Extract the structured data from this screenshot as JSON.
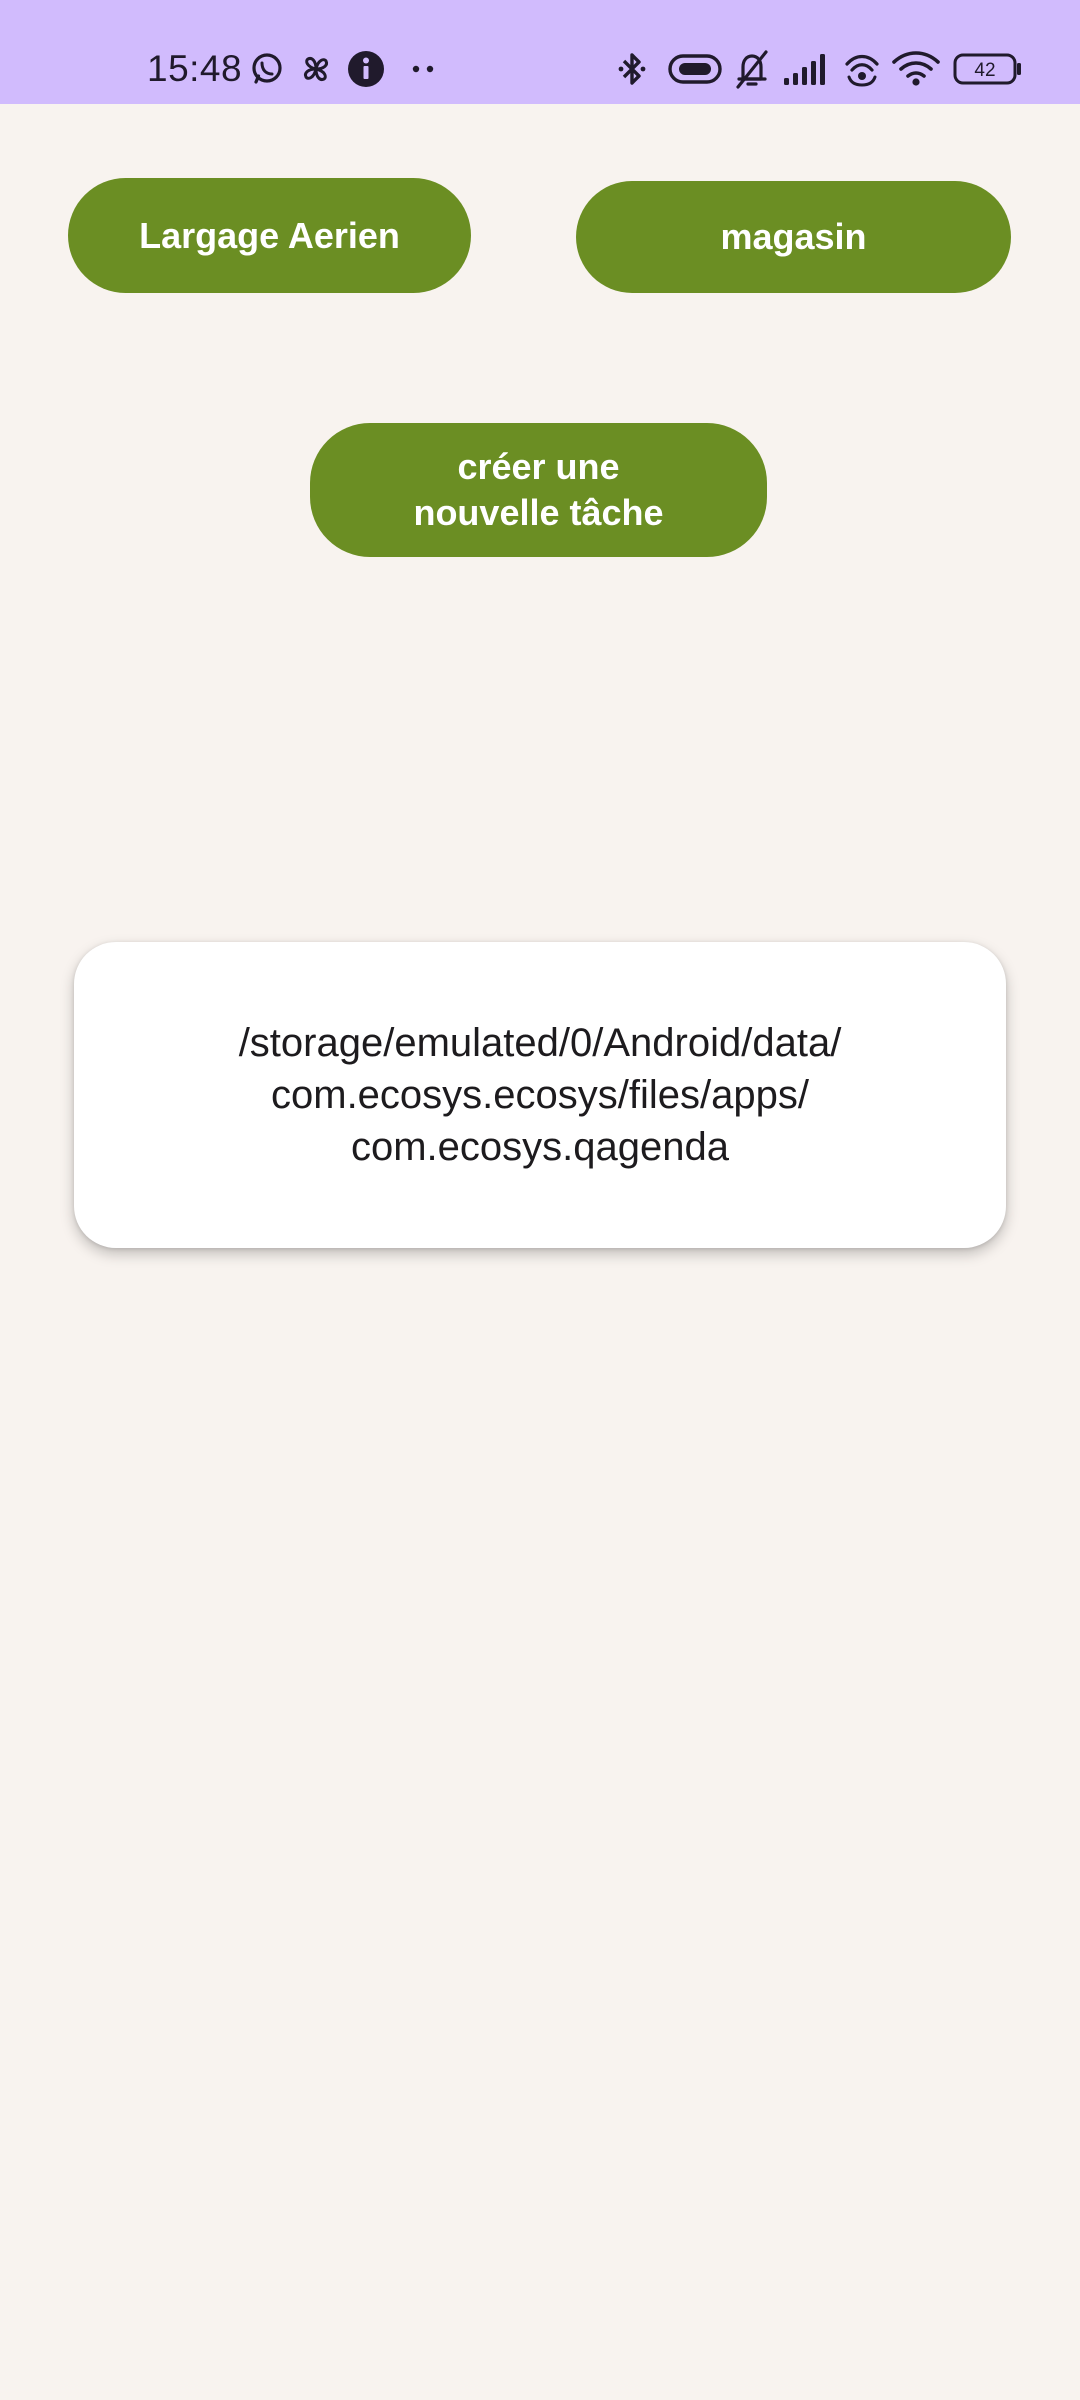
{
  "status_bar": {
    "time": "15:48",
    "battery_level": "42",
    "background_color": "#d1bbfd",
    "left_icons": [
      "whatsapp-icon",
      "pinwheel-icon",
      "info-icon",
      "more-dots-icon"
    ],
    "right_icons": [
      "bluetooth-icon",
      "link-icon",
      "bell-off-icon",
      "signal-icon",
      "hotspot-icon",
      "wifi-icon",
      "battery-icon"
    ]
  },
  "buttons": {
    "largage_label": "Largage Aerien",
    "magasin_label": "magasin",
    "create_task_label": "créer une\nnouvelle tâche",
    "color": "#6b8e23"
  },
  "path_card": {
    "text": "/storage/emulated/0/Android/data/\ncom.ecosys.ecosys/files/apps/\ncom.ecosys.qagenda"
  },
  "colors": {
    "background": "#f8f3ef",
    "button": "#6b8e23",
    "card": "#ffffff"
  }
}
